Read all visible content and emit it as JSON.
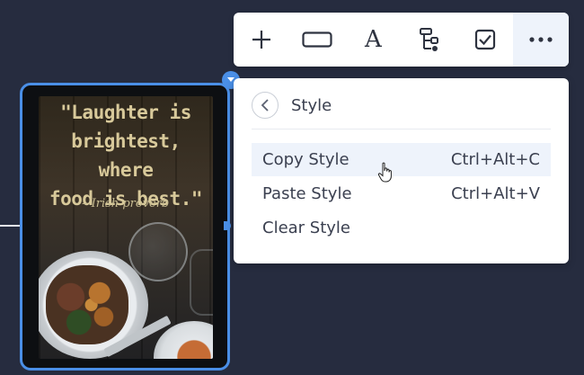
{
  "canvas": {
    "background": "#262c3f",
    "accent": "#4a8fe7"
  },
  "card": {
    "quote": "\"Laughter is brightest, where food is best.\"",
    "quote_lines": [
      "\"Laughter is",
      "brightest, where",
      "food is best.\""
    ],
    "attribution": "– Irish proverb"
  },
  "toolbar": {
    "buttons": [
      {
        "name": "add",
        "icon": "plus-icon"
      },
      {
        "name": "shape",
        "icon": "rectangle-icon"
      },
      {
        "name": "text",
        "icon": "text-icon",
        "label": "A"
      },
      {
        "name": "structure",
        "icon": "tree-structure-icon"
      },
      {
        "name": "task",
        "icon": "checkbox-icon"
      },
      {
        "name": "more",
        "icon": "more-dots-icon"
      }
    ]
  },
  "menu": {
    "title": "Style",
    "back_icon": "chevron-left-icon",
    "items": [
      {
        "label": "Copy Style",
        "shortcut": "Ctrl+Alt+C"
      },
      {
        "label": "Paste Style",
        "shortcut": "Ctrl+Alt+V"
      },
      {
        "label": "Clear Style",
        "shortcut": ""
      }
    ]
  },
  "pin_icon": "chevron-down-icon",
  "cursor_icon": "hand-pointer-icon"
}
